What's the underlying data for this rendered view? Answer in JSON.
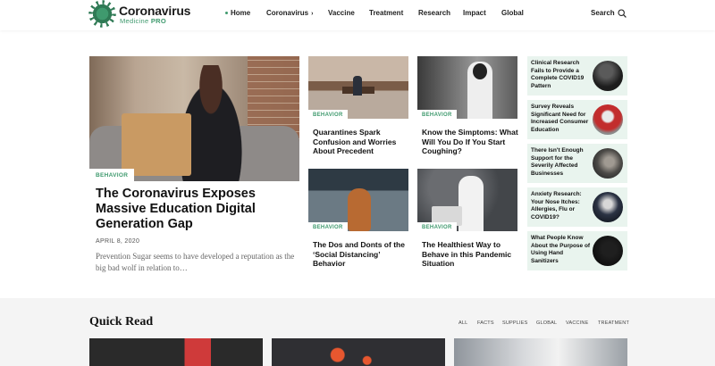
{
  "brand": {
    "name": "Coronavirus",
    "tagline": "Medicine",
    "tagline_badge": "PRO",
    "accent_color": "#3f9a6e"
  },
  "nav": {
    "items": [
      {
        "label": "Home",
        "active": true
      },
      {
        "label": "Coronavirus",
        "has_dropdown": true
      },
      {
        "label": "Vaccine"
      },
      {
        "label": "Treatment"
      },
      {
        "label": "Research"
      },
      {
        "label": "Impact"
      },
      {
        "label": "Global"
      }
    ],
    "search_label": "Search",
    "search_icon": "search-icon"
  },
  "hero": {
    "category": "BEHAVIOR",
    "title": "The Coronavirus Exposes Massive Education Digital Generation Gap",
    "date": "APRIL 8, 2020",
    "excerpt": "Prevention Sugar seems to have developed a reputation as the big bad wolf in relation to…"
  },
  "cards": [
    {
      "category": "BEHAVIOR",
      "title": "Quarantines Spark Confusion and Worries About Precedent"
    },
    {
      "category": "BEHAVIOR",
      "title": "Know the Simptoms: What Will You Do If You Start Coughing?"
    },
    {
      "category": "BEHAVIOR",
      "title": "The Dos and Donts of the ‘Social Distancing’ Behavior"
    },
    {
      "category": "BEHAVIOR",
      "title": "The Healthiest Way to Behave in this Pandemic Situation"
    }
  ],
  "sidebar": {
    "items": [
      {
        "title": "Clinical Research Fails to Provide a Complete COVID19 Pattern"
      },
      {
        "title": "Survey Reveals Significant Need for Increased Consumer Education"
      },
      {
        "title": "There Isn't Enough Support for the Severily Affected Businesses"
      },
      {
        "title": "Anxiety Research: Your Nose Itches: Allergies, Flu or COVID19?"
      },
      {
        "title": "What People Know About the Purpose of Using Hand Sanitizers"
      }
    ]
  },
  "quick_read": {
    "title": "Quick Read",
    "filters": [
      "ALL",
      "FACTS",
      "SUPPLIES",
      "GLOBAL",
      "VACCINE",
      "TREATMENT"
    ]
  }
}
